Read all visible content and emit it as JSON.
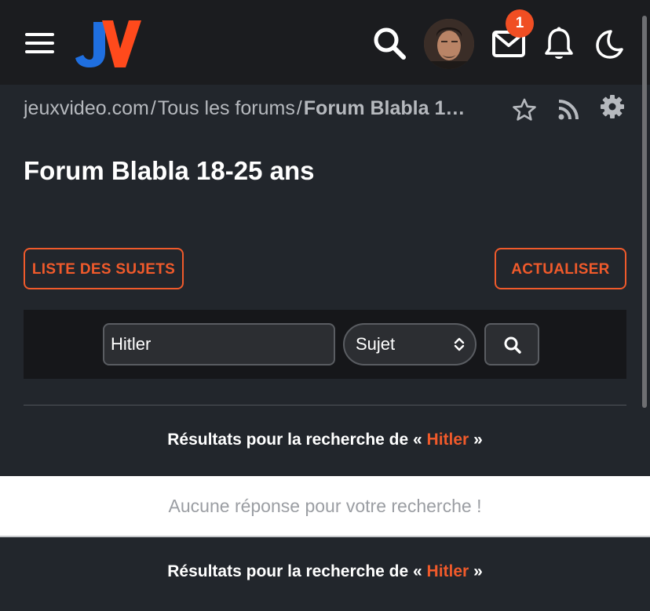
{
  "header": {
    "logo_text": "JV",
    "notification_count": "1",
    "icons": [
      "menu-icon",
      "search-icon",
      "avatar",
      "mail-icon",
      "bell-icon",
      "moon-icon"
    ]
  },
  "breadcrumb": {
    "items": [
      "jeuxvideo.com",
      "Tous les forums",
      "Forum Blabla 1…"
    ],
    "separator": "/"
  },
  "page": {
    "title": "Forum Blabla 18-25 ans"
  },
  "buttons": {
    "list_topics": "LISTE DES SUJETS",
    "refresh": "ACTUALISER"
  },
  "search": {
    "query": "Hitler",
    "type_selected": "Sujet"
  },
  "results": {
    "prefix": "Résultats pour la recherche de « ",
    "term": "Hitler",
    "suffix": " »",
    "empty_message": "Aucune réponse pour votre recherche !"
  },
  "colors": {
    "accent": "#f05a2b",
    "badge": "#f04e23",
    "header_bg": "#1b1c1f",
    "page_bg": "#22262c",
    "logo_blue": "#1f6fe0",
    "logo_orange": "#ff4a1c"
  }
}
